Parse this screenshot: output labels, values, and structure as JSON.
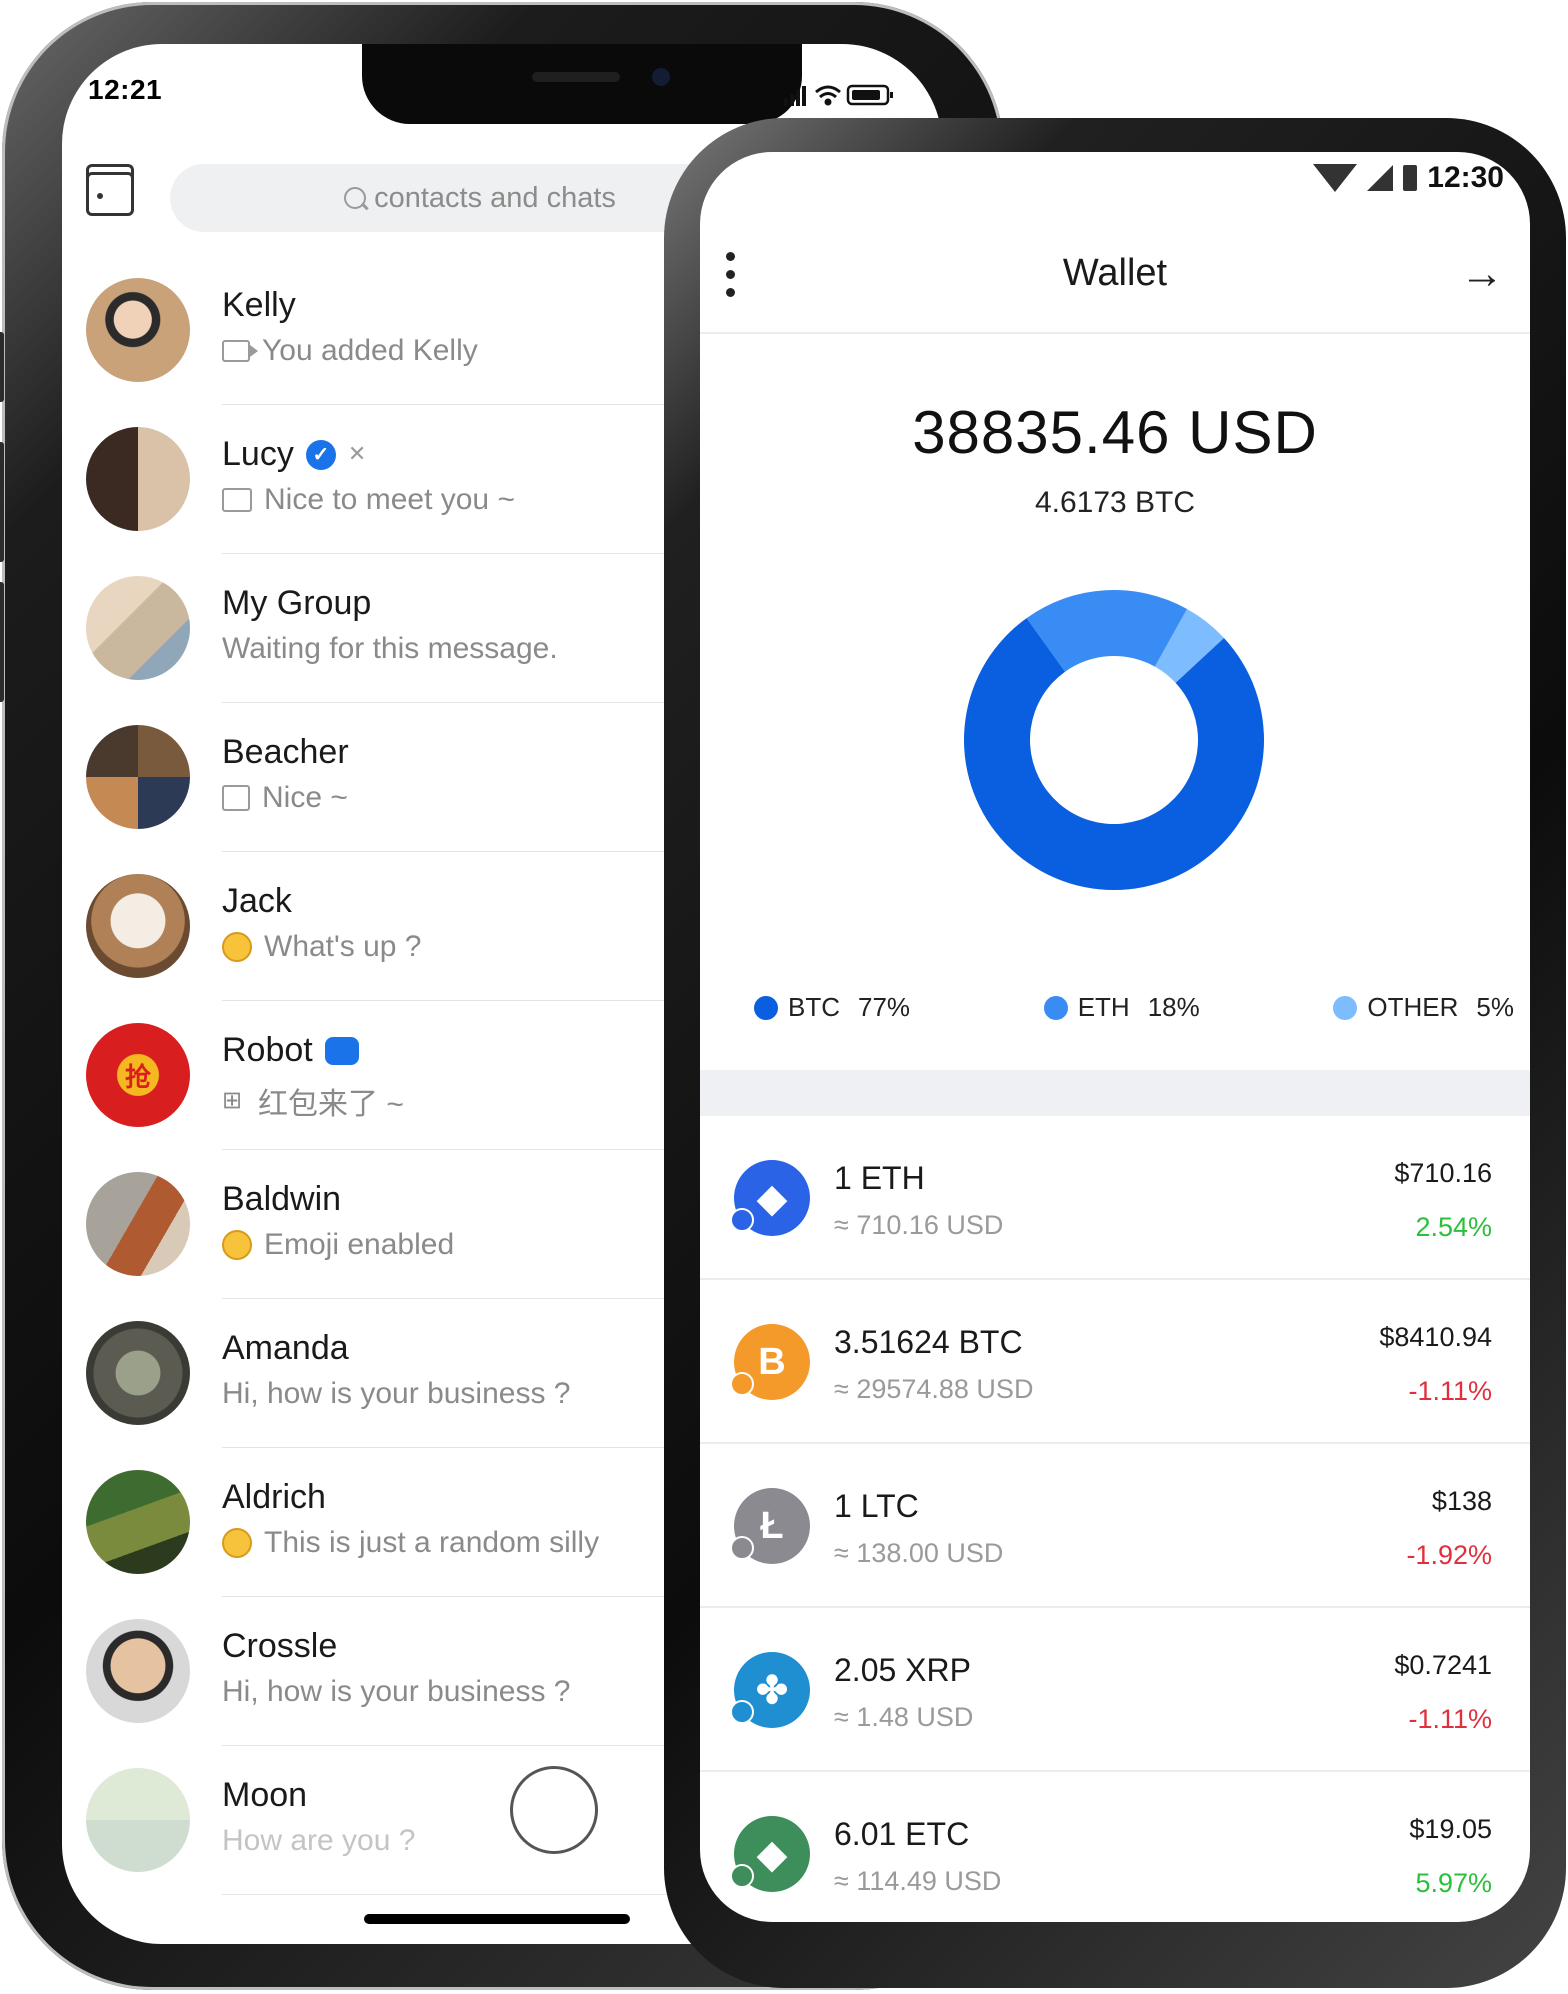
{
  "left_phone": {
    "status_time": "12:21",
    "search_placeholder": "contacts and chats",
    "chats": [
      {
        "name": "Kelly",
        "preview": "You added Kelly",
        "preview_icon": "video-icon"
      },
      {
        "name": "Lucy",
        "preview": "Nice to meet you ~",
        "preview_icon": "image-icon",
        "verified": true,
        "muted": true
      },
      {
        "name": "My Group",
        "preview": "Waiting for this message.",
        "preview_icon": ""
      },
      {
        "name": "Beacher",
        "preview": "Nice ~",
        "preview_icon": "file-icon"
      },
      {
        "name": "Jack",
        "preview": "What's up ?",
        "preview_icon": "emoji-icon"
      },
      {
        "name": "Robot",
        "preview": "红包来了 ~",
        "preview_icon": "app-icon",
        "avatar_text": "抢"
      },
      {
        "name": "Baldwin",
        "preview": "Emoji enabled",
        "preview_icon": "emoji-icon"
      },
      {
        "name": "Amanda",
        "preview": "Hi, how is your business ?",
        "preview_icon": ""
      },
      {
        "name": "Aldrich",
        "preview": "This is just a random silly",
        "preview_icon": "emoji-icon"
      },
      {
        "name": "Crossle",
        "preview": "Hi, how is your business ?",
        "preview_icon": ""
      },
      {
        "name": "Moon",
        "preview": "How are you ?",
        "preview_icon": ""
      }
    ]
  },
  "right_phone": {
    "status_time": "12:30",
    "title": "Wallet",
    "balance_usd": "38835.46 USD",
    "balance_btc": "4.6173 BTC",
    "legend": [
      {
        "label": "BTC",
        "percent": "77%",
        "color": "#0a5fe0"
      },
      {
        "label": "ETH",
        "percent": "18%",
        "color": "#3a8cf5"
      },
      {
        "label": "OTHER",
        "percent": "5%",
        "color": "#7cbcff"
      }
    ],
    "assets": [
      {
        "amount": "1 ETH",
        "approx": "≈ 710.16 USD",
        "price": "$710.16",
        "change": "2.54%",
        "direction": "up",
        "color": "#2a63e6",
        "symbol": "◆"
      },
      {
        "amount": "3.51624 BTC",
        "approx": "≈ 29574.88 USD",
        "price": "$8410.94",
        "change": "-1.11%",
        "direction": "down",
        "color": "#f39a2b",
        "symbol": "B"
      },
      {
        "amount": "1 LTC",
        "approx": "≈ 138.00 USD",
        "price": "$138",
        "change": "-1.92%",
        "direction": "down",
        "color": "#8a8a90",
        "symbol": "Ł"
      },
      {
        "amount": "2.05 XRP",
        "approx": "≈ 1.48 USD",
        "price": "$0.7241",
        "change": "-1.11%",
        "direction": "down",
        "color": "#1f8fd1",
        "symbol": "✤"
      },
      {
        "amount": "6.01 ETC",
        "approx": "≈ 114.49 USD",
        "price": "$19.05",
        "change": "5.97%",
        "direction": "up",
        "color": "#3d8e5a",
        "symbol": "◆"
      }
    ]
  },
  "chart_data": {
    "type": "pie",
    "categories": [
      "BTC",
      "ETH",
      "OTHER"
    ],
    "values": [
      77,
      18,
      5
    ],
    "colors": [
      "#0a5fe0",
      "#3a8cf5",
      "#7cbcff"
    ]
  }
}
